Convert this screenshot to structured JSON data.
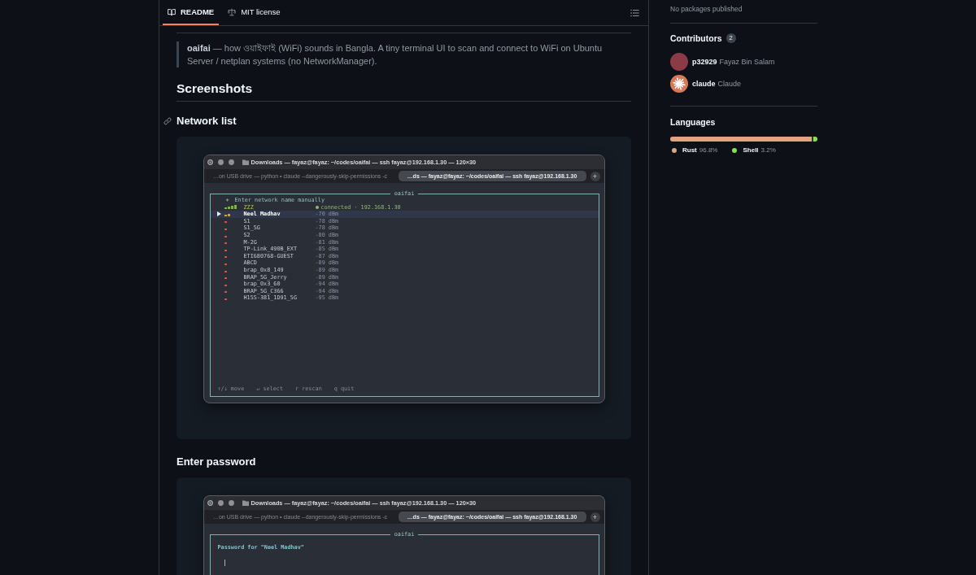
{
  "readme_tabs": [
    {
      "label": "README",
      "selected": true
    },
    {
      "label": "MIT license",
      "selected": false
    }
  ],
  "blockquote": "**oaifai** — how ওয়াইফাই (WiFi) sounds in Bangla. A tiny terminal UI to scan and connect to WiFi on Ubuntu Server / netplan systems (no NetworkManager).",
  "section": {
    "heading": "Screenshots",
    "figures": [
      {
        "heading": "Network list",
        "hovered": true,
        "terminal": {
          "title": "Downloads — fayaz@fayaz: ~/codes/oaifai — ssh fayaz@192.168.1.30 — 120×30",
          "tabs": [
            {
              "label": "…on USB drive — python • claude --dangerously-skip-permissions -c",
              "selected": false
            },
            {
              "label": "…ds — fayaz@fayaz: ~/codes/oaifai — ssh fayaz@192.168.1.30",
              "selected": true
            }
          ],
          "new_tab": "+",
          "app": "oaifai",
          "kind": "network_list",
          "manual_entry": {
            "symbol": "+",
            "label": "Enter network name manually"
          },
          "networks": [
            {
              "name": "ZZZ",
              "kind": "strong",
              "color": "#7db24a",
              "connected": true,
              "selected": false,
              "reading": "connected · 192.168.1.30"
            },
            {
              "name": "Neel Madhav",
              "kind": "fair",
              "color": "#cba442",
              "connected": false,
              "selected": true,
              "reading": "-70 dBm"
            },
            {
              "name": "S1",
              "kind": "weak",
              "color": "#cf5248",
              "connected": false,
              "selected": false,
              "reading": "-78 dBm"
            },
            {
              "name": "S1_5G",
              "kind": "weak",
              "color": "#cf5248",
              "connected": false,
              "selected": false,
              "reading": "-78 dBm"
            },
            {
              "name": "S2",
              "kind": "weak",
              "color": "#cf5248",
              "connected": false,
              "selected": false,
              "reading": "-80 dBm"
            },
            {
              "name": "M-2G",
              "kind": "weak",
              "color": "#cf5248",
              "connected": false,
              "selected": false,
              "reading": "-81 dBm"
            },
            {
              "name": "TP-Link_490B_EXT",
              "kind": "weak",
              "color": "#cf5248",
              "connected": false,
              "selected": false,
              "reading": "-85 dBm"
            },
            {
              "name": "ETI680768-GUEST",
              "kind": "weak",
              "color": "#cf5248",
              "connected": false,
              "selected": false,
              "reading": "-87 dBm"
            },
            {
              "name": "ABCD",
              "kind": "weak",
              "color": "#cf5248",
              "connected": false,
              "selected": false,
              "reading": "-89 dBm"
            },
            {
              "name": "brap_0x8_149",
              "kind": "weak",
              "color": "#cf5248",
              "connected": false,
              "selected": false,
              "reading": "-89 dBm"
            },
            {
              "name": "BRAP_5G_Jerry",
              "kind": "weak",
              "color": "#cf5248",
              "connected": false,
              "selected": false,
              "reading": "-89 dBm"
            },
            {
              "name": "brap_0x3_60",
              "kind": "weak",
              "color": "#cf5248",
              "connected": false,
              "selected": false,
              "reading": "-94 dBm"
            },
            {
              "name": "BRAP_5G_C366",
              "kind": "weak",
              "color": "#cf5248",
              "connected": false,
              "selected": false,
              "reading": "-94 dBm"
            },
            {
              "name": "H155-381_1D91_5G",
              "kind": "weak",
              "color": "#cf5248",
              "connected": false,
              "selected": false,
              "reading": "-95 dBm"
            }
          ],
          "hints": [
            "↑/↓ move",
            "↵ select",
            "r rescan",
            "q quit"
          ]
        }
      },
      {
        "heading": "Enter password",
        "hovered": false,
        "terminal": {
          "title": "Downloads — fayaz@fayaz: ~/codes/oaifai — ssh fayaz@192.168.1.30 — 120×30",
          "tabs": [
            {
              "label": "…on USB drive — python • claude --dangerously-skip-permissions -c",
              "selected": false
            },
            {
              "label": "…ds — fayaz@fayaz: ~/codes/oaifai — ssh fayaz@192.168.1.30",
              "selected": true
            }
          ],
          "new_tab": "+",
          "app": "oaifai",
          "kind": "password",
          "prompt": "Password for \"Neel Madhav\""
        }
      }
    ]
  },
  "sidebar": {
    "packages": "No packages published",
    "contributors": {
      "heading": "Contributors",
      "count": "2",
      "people": [
        {
          "login": "p32929",
          "name": "Fayaz Bin Salam",
          "kind": "photo"
        },
        {
          "login": "claude",
          "name": "Claude",
          "kind": "logo"
        }
      ]
    },
    "languages": {
      "heading": "Languages",
      "items": [
        {
          "name": "Rust",
          "percent": "96.8%",
          "color": "#dea584",
          "level": 0.968
        },
        {
          "name": "Shell",
          "percent": "3.2%",
          "color": "#89e051",
          "level": 0.032
        }
      ]
    }
  }
}
